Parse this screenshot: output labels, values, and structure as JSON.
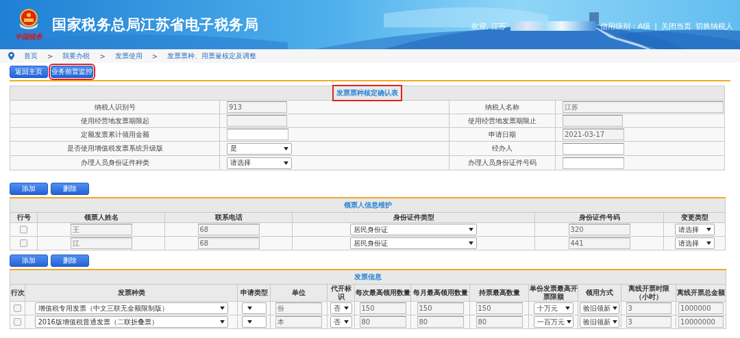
{
  "header": {
    "title": "国家税务总局江苏省电子税务局",
    "brand_mark": "中国税务",
    "welcome": "欢迎, 江苏",
    "credit": "信用级别：A级",
    "divider": "|",
    "links": [
      "关闭当页",
      "切换纳税人"
    ]
  },
  "breadcrumb": {
    "separator": ">",
    "items": [
      "首页",
      "我要办税",
      "发票使用",
      "发票票种、用票量核定及调整"
    ]
  },
  "top_buttons": [
    {
      "label": "返回主页",
      "highlighted": false
    },
    {
      "label": "业务前置监控",
      "highlighted": true
    }
  ],
  "confirm_form": {
    "title": "发票票种核定确认表",
    "title_highlighted": true,
    "rows": [
      {
        "label": "纳税人识别号",
        "field": {
          "kind": "readonly",
          "value": "913"
        }
      },
      {
        "label": "纳税人名称",
        "field": {
          "kind": "readonly",
          "value": "江苏"
        }
      },
      {
        "label": "使用经营地发票期限起",
        "field": {
          "kind": "readonly"
        }
      },
      {
        "label": "使用经营地发票期限止",
        "field": {
          "kind": "readonly"
        }
      },
      {
        "label": "定额发票累计领用金额",
        "field": {
          "kind": "input"
        }
      },
      {
        "label": "申请日期",
        "field": {
          "kind": "readonly",
          "value": "2021-03-17"
        }
      },
      {
        "label": "是否使用增值税发票系统升级版",
        "field": {
          "kind": "select",
          "value": "是"
        }
      },
      {
        "label": "经办人",
        "field": {
          "kind": "input"
        }
      },
      {
        "label": "办理人员身份证件种类",
        "field": {
          "kind": "select",
          "value": "请选择"
        }
      },
      {
        "label": "办理人员身份证件号码",
        "field": {
          "kind": "input"
        }
      }
    ]
  },
  "recipients": {
    "buttons": [
      "添加",
      "删除"
    ],
    "title": "领票人信息维护",
    "columns": [
      "行号",
      "领票人姓名",
      "联系电话",
      "身份证件类型",
      "身份证件号码",
      "变更类型"
    ],
    "rows": [
      {
        "cells": [
          {
            "kind": "checkbox",
            "checked": false
          },
          {
            "kind": "readonly",
            "value": "王"
          },
          {
            "kind": "readonly",
            "value": "68"
          },
          {
            "kind": "select",
            "value": "居民身份证"
          },
          {
            "kind": "readonly",
            "value": "320"
          },
          {
            "kind": "select",
            "value": "请选择"
          }
        ]
      },
      {
        "cells": [
          {
            "kind": "checkbox",
            "checked": false
          },
          {
            "kind": "readonly",
            "value": "江"
          },
          {
            "kind": "readonly",
            "value": "68"
          },
          {
            "kind": "select",
            "value": "居民身份证"
          },
          {
            "kind": "readonly",
            "value": "441"
          },
          {
            "kind": "select",
            "value": "请选择"
          }
        ]
      }
    ]
  },
  "invoices": {
    "buttons": [
      "添加",
      "删除"
    ],
    "title": "发票信息",
    "columns": [
      "行次",
      "发票种类",
      "申请类型",
      "单位",
      "代开标识",
      "每次最高领用数量",
      "每月最高领用数量",
      "持票最高数量",
      "单份发票最高开票限额",
      "领用方式",
      "离线开票时限（小时）",
      "离线开票总金额"
    ],
    "rows": [
      {
        "cells": [
          {
            "kind": "checkbox",
            "checked": false
          },
          {
            "kind": "select",
            "value": "增值税专用发票（中文三联无金额限制版）"
          },
          {
            "kind": "select"
          },
          {
            "kind": "readonly",
            "value": "份"
          },
          {
            "kind": "select",
            "value": "否"
          },
          {
            "kind": "readonly",
            "value": "150"
          },
          {
            "kind": "readonly",
            "value": "150"
          },
          {
            "kind": "readonly",
            "value": "150"
          },
          {
            "kind": "select",
            "value": "十万元"
          },
          {
            "kind": "select",
            "value": "验旧领新"
          },
          {
            "kind": "readonly",
            "value": "3"
          },
          {
            "kind": "readonly",
            "value": "1000000"
          }
        ]
      },
      {
        "cells": [
          {
            "kind": "checkbox",
            "checked": false
          },
          {
            "kind": "select",
            "value": "2016版增值税普通发票（二联折叠票）"
          },
          {
            "kind": "select"
          },
          {
            "kind": "readonly",
            "value": "本"
          },
          {
            "kind": "select",
            "value": "否"
          },
          {
            "kind": "readonly",
            "value": "80"
          },
          {
            "kind": "readonly",
            "value": "80"
          },
          {
            "kind": "readonly",
            "value": "80"
          },
          {
            "kind": "select",
            "value": "一百万元"
          },
          {
            "kind": "select",
            "value": "验旧领新"
          },
          {
            "kind": "readonly",
            "value": "3"
          },
          {
            "kind": "readonly",
            "value": "10000000"
          }
        ]
      }
    ]
  }
}
